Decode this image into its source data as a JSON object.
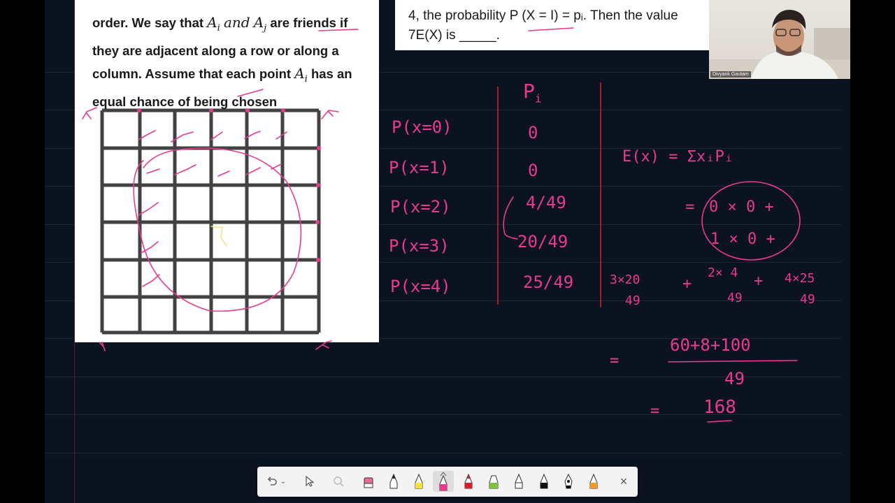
{
  "problem": {
    "line1_pre": "order. We say that",
    "line1_math_a": "A",
    "line1_math_a_sub": "i",
    "line1_and": "and",
    "line1_math_b": "A",
    "line1_math_b_sub": "j",
    "line1_post": "are friends if",
    "line2": "they are adjacent along a row or along a",
    "line3_pre": "column. Assume that each point",
    "line3_math": "A",
    "line3_math_sub": "i",
    "line3_post": "has an",
    "line4": "equal chance of being chosen"
  },
  "question": {
    "line1": "4, the probability P (X = I) = pᵢ. Then the value",
    "line2": "7E(X) is _____."
  },
  "webcam": {
    "name": "Divyank Gautam"
  },
  "ink": {
    "header_pi": "P",
    "header_pi_sub": "i",
    "rows": [
      {
        "label": "P(x=0)",
        "value": "0"
      },
      {
        "label": "P(x=1)",
        "value": "0"
      },
      {
        "label": "P(x=2)",
        "value": "4/49"
      },
      {
        "label": "P(x=3)",
        "value": "20/49"
      },
      {
        "label": "P(x=4)",
        "value": "25/49"
      }
    ],
    "expectation": "E(x) = ΣxᵢPᵢ",
    "circle_line1": "0 × 0 +",
    "circle_line2": "1 × 0 +",
    "eq_sign": "=",
    "term1_num": "3×20",
    "term1_den": "49",
    "plus1": "+",
    "term2_num": "2× 4",
    "term2_den": "49",
    "plus2": "+",
    "term3_num": "4×25",
    "term3_den": "49",
    "sum_eq": "=",
    "sum_num": "60+8+100",
    "sum_den": "49",
    "result_eq": "=",
    "result": "168"
  },
  "toolbar": {
    "close_label": "×"
  },
  "colors": {
    "ink_pink": "#e83a8f",
    "ink_red": "#d81e2c",
    "board": "#0b1220"
  }
}
